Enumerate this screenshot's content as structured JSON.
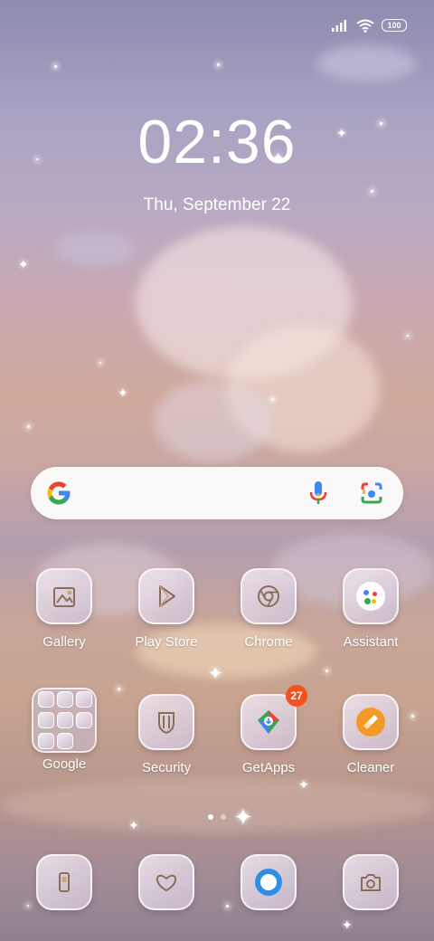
{
  "status_bar": {
    "battery": "100",
    "icons": [
      "signal-icon",
      "wifi-icon",
      "battery-icon"
    ]
  },
  "lock": {
    "time": "02:36",
    "date": "Thu, September 22"
  },
  "search_bar": {
    "icons": [
      "google-g-icon",
      "mic-icon",
      "lens-icon"
    ]
  },
  "apps_row1": [
    {
      "label": "Gallery",
      "icon": "gallery-icon"
    },
    {
      "label": "Play Store",
      "icon": "play-store-icon"
    },
    {
      "label": "Chrome",
      "icon": "chrome-icon"
    },
    {
      "label": "Assistant",
      "icon": "assistant-icon"
    }
  ],
  "apps_row2": [
    {
      "label": "Google",
      "icon": "folder-icon"
    },
    {
      "label": "Security",
      "icon": "security-shield-icon"
    },
    {
      "label": "GetApps",
      "icon": "getapps-icon",
      "badge": "27"
    },
    {
      "label": "Cleaner",
      "icon": "cleaner-brush-icon"
    }
  ],
  "dock": [
    {
      "icon": "phone-icon"
    },
    {
      "icon": "messages-icon"
    },
    {
      "icon": "browser-icon"
    },
    {
      "icon": "camera-icon"
    }
  ],
  "page_indicator": {
    "pages": 2,
    "current": 1
  },
  "colors": {
    "badge": "#f4511e",
    "google_blue": "#4285F4",
    "google_red": "#EA4335",
    "google_yellow": "#FBBC05",
    "google_green": "#34A853"
  }
}
